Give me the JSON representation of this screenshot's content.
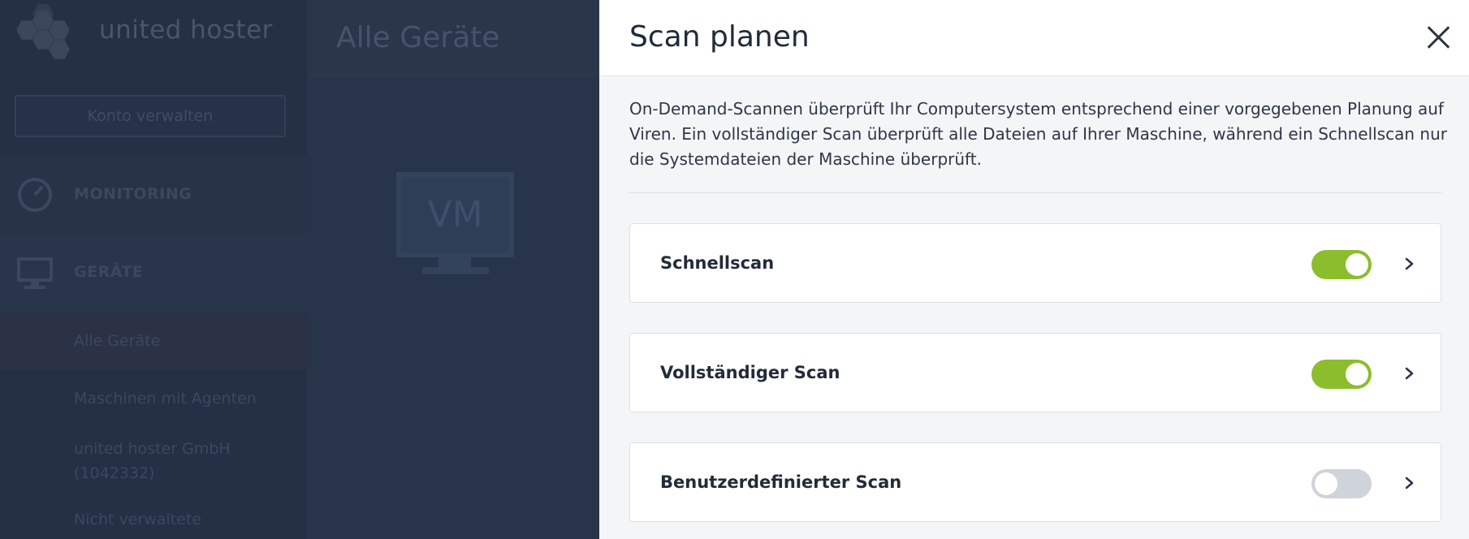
{
  "background": {
    "brand": "united hoster",
    "manage_account_label": "Konto verwalten",
    "nav": {
      "monitoring_label": "MONITORING",
      "devices_label": "GERÄTE"
    },
    "subnav": {
      "all_devices": "Alle Geräte",
      "machines_with_agents": "Maschinen mit Agenten",
      "company": "united hoster GmbH (1042332)",
      "unmanaged": "Nicht verwaltete"
    },
    "page_title": "Alle Geräte",
    "vm_label": "VM"
  },
  "panel": {
    "title": "Scan planen",
    "description": "On-Demand-Scannen überprüft Ihr Computersystem entsprechend einer vorgegebenen Planung auf Viren. Ein vollständiger Scan überprüft alle Dateien auf Ihrer Maschine, während ein Schnellscan nur die Systemdateien der Maschine überprüft.",
    "scans": [
      {
        "label": "Schnellscan",
        "enabled": true
      },
      {
        "label": "Vollständiger Scan",
        "enabled": true
      },
      {
        "label": "Benutzerdefinierter Scan",
        "enabled": false
      }
    ]
  },
  "colors": {
    "toggle_on": "#8cbd2c",
    "toggle_off": "#cfd3da",
    "overlay_sidebar": "#243043"
  },
  "icons": {
    "close": "close-icon",
    "chevron": "chevron-right-icon",
    "monitoring": "speedometer-icon",
    "devices": "monitor-icon"
  }
}
